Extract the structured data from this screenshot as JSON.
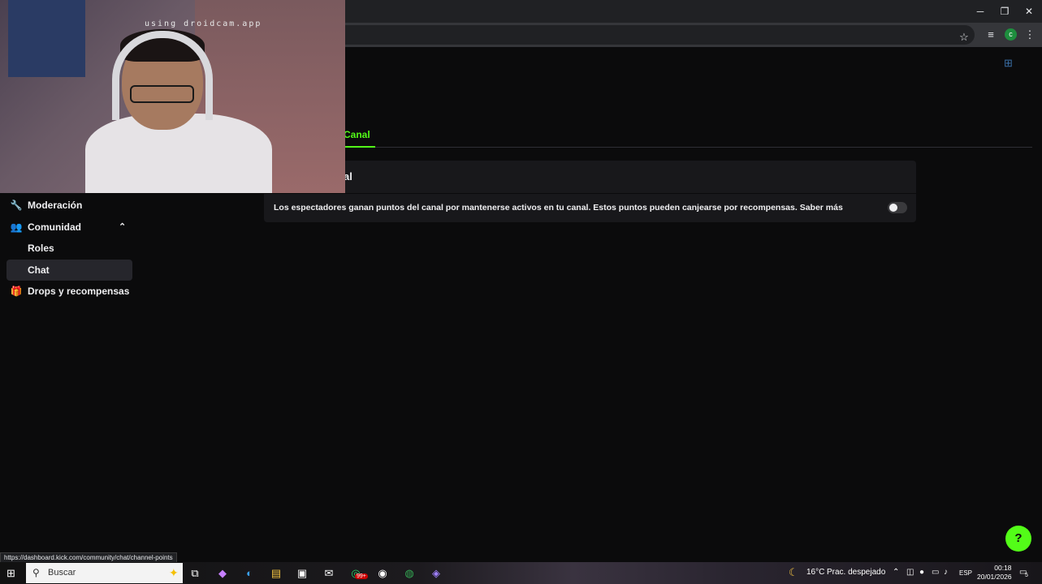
{
  "browser": {
    "window_controls": {
      "minimize": "─",
      "restore": "❐",
      "close": "✕"
    },
    "profile_letter": "c"
  },
  "page": {
    "tab_active_label": "Canal",
    "card_title": "al",
    "card_description": "Los espectadores ganan puntos del canal por mantenerse activos en tu canal. Estos puntos pueden canjearse por recompensas. Saber más",
    "toggle_on": false
  },
  "sidebar": {
    "items": [
      {
        "label": "Moderación",
        "icon": "wrench-icon"
      },
      {
        "label": "Comunidad",
        "icon": "community-icon"
      },
      {
        "label": "Roles",
        "icon": ""
      },
      {
        "label": "Chat",
        "icon": ""
      },
      {
        "label": "Drops y recompensas",
        "icon": "gift-icon"
      }
    ]
  },
  "webcam": {
    "watermark": "using droidcam.app"
  },
  "status_url": "https://dashboard.kick.com/community/chat/channel-points",
  "taskbar": {
    "search_placeholder": "Buscar",
    "whatsapp_badge": "99+",
    "weather_temp": "16°C",
    "weather_desc": "Prac. despejado",
    "language": "ESP",
    "time": "00:18",
    "date": "20/01/2026",
    "notification_count": "5"
  },
  "colors": {
    "accent": "#53fc18",
    "background": "#0b0b0c",
    "card": "#18181b"
  }
}
